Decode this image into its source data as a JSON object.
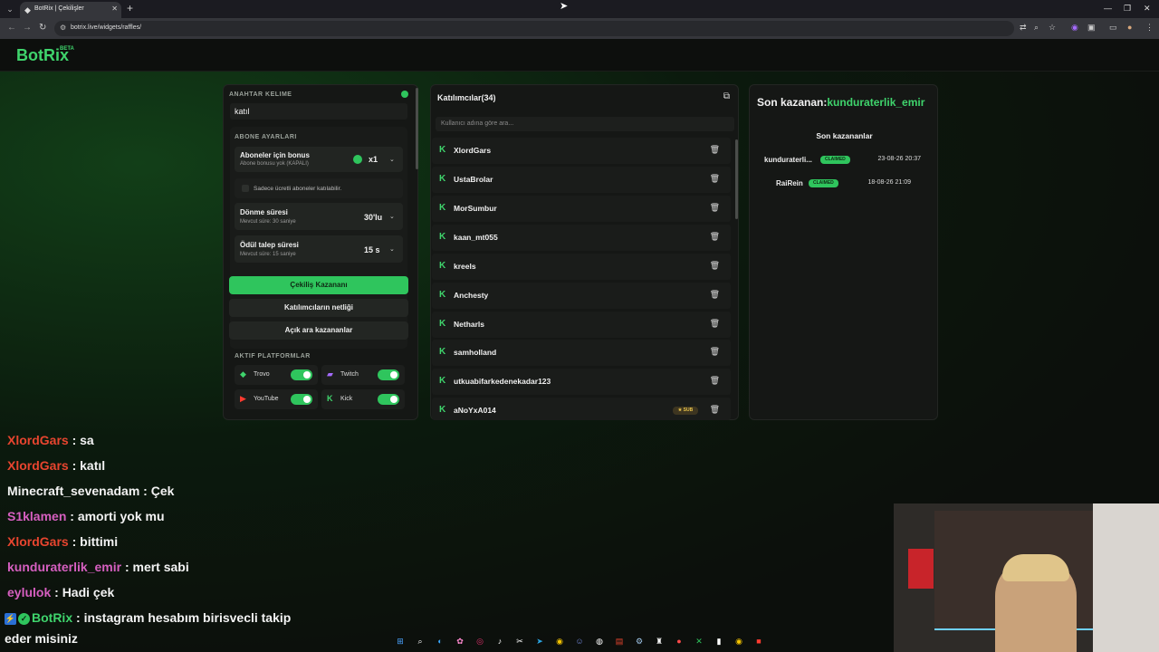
{
  "browser": {
    "tab_title": "BotRix | Çekilişler",
    "url": "botrix.live/widgets/raffles/"
  },
  "header": {
    "logo": "BotRix",
    "beta": "BETA"
  },
  "settings": {
    "keyword_label": "ANAHTAR KELIME",
    "keyword_value": "katıl",
    "subscriber_settings_label": "ABONE AYARLARI",
    "bonus_title": "Aboneler için bonus",
    "bonus_sub": "Abone bonusu yok (KAPALI)",
    "bonus_value": "x1",
    "only_paid_label": "Sadece ücretli aboneler katılabilir.",
    "spin_title": "Dönme süresi",
    "spin_sub": "Mevcut süre: 30 saniye",
    "spin_value": "30'lu",
    "claim_title": "Ödül talep süresi",
    "claim_sub": "Mevcut süre: 15 saniye",
    "claim_value": "15 s",
    "draw_button": "Çekiliş Kazananı",
    "clear_button": "Katılımcıların netliği",
    "open_winners_button": "Açık ara kazananlar",
    "platforms_label": "AKTIF PLATFORMLAR",
    "platforms": [
      {
        "name": "Trovo",
        "on": true
      },
      {
        "name": "Twitch",
        "on": true
      },
      {
        "name": "YouTube",
        "on": true
      },
      {
        "name": "Kick",
        "on": true
      }
    ]
  },
  "participants": {
    "title": "Katılımcılar(34)",
    "search_placeholder": "Kullanıcı adına göre ara...",
    "list": [
      {
        "name": "XlordGars"
      },
      {
        "name": "UstaBrolar"
      },
      {
        "name": "MorSumbur"
      },
      {
        "name": "kaan_mt055"
      },
      {
        "name": "kreels"
      },
      {
        "name": "Anchesty"
      },
      {
        "name": "Netharls"
      },
      {
        "name": "samholland"
      },
      {
        "name": "utkuabifarkedenekadar123"
      },
      {
        "name": "aNoYxA014",
        "badge": "★ SUB"
      }
    ]
  },
  "winners": {
    "last_label": "Son kazanan:",
    "last_name": "kunduraterlik_emir",
    "recent_title": "Son kazananlar",
    "rows": [
      {
        "name": "kunduraterli...",
        "status": "CLAIMED",
        "date": "23-08-26 20:37"
      },
      {
        "name": "RaiRein",
        "status": "CLAIMED",
        "date": "18-08-26 21:09"
      }
    ]
  },
  "chat": [
    {
      "user": "XlordGars",
      "color": "#e8452f",
      "msg": " : sa"
    },
    {
      "user": "XlordGars",
      "color": "#e8452f",
      "msg": " : katıl"
    },
    {
      "user": "Minecraft_sevenadam",
      "color": "#f3f3f3",
      "msg": " : Çek"
    },
    {
      "user": "S1klamen",
      "color": "#d65fc0",
      "msg": " : amorti yok mu"
    },
    {
      "user": "XlordGars",
      "color": "#e8452f",
      "msg": " : bittimi"
    },
    {
      "user": "kunduraterlik_emir",
      "color": "#d65fc0",
      "msg": " : mert sabi"
    },
    {
      "user": "eylulok",
      "color": "#d65fc0",
      "msg": " : Hadi çek"
    },
    {
      "user": "BotRix",
      "color": "#3fd46c",
      "msg": " : instagram hesabım birisvecli takip"
    }
  ],
  "chat_continuation": "eder misiniz",
  "colors": {
    "accent": "#2fc55d",
    "sub_badge": "#e8c24a"
  }
}
